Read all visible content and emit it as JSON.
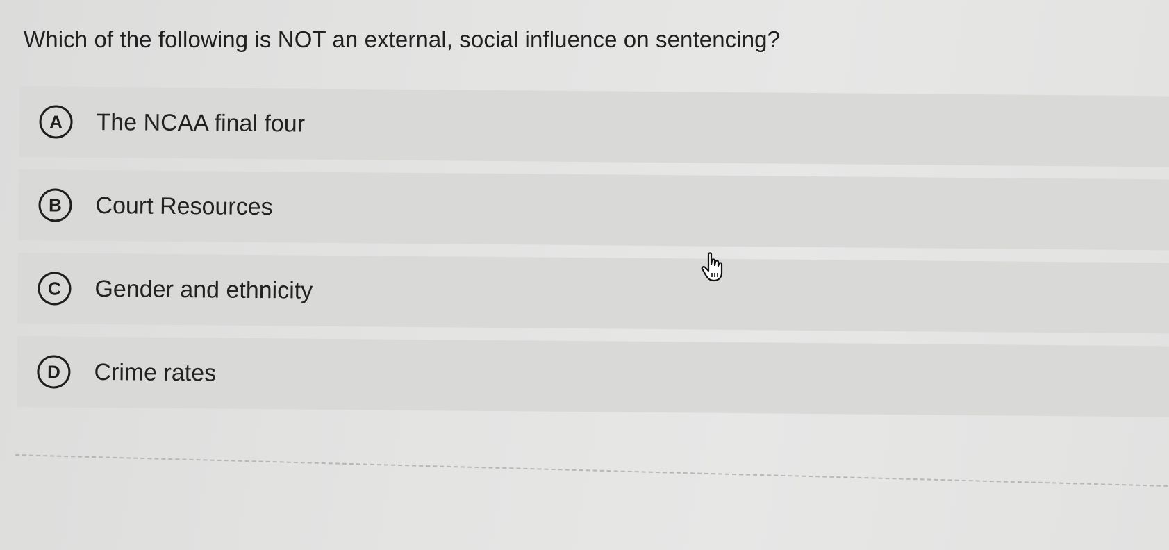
{
  "question": {
    "text": "Which of the following is NOT an external, social influence on sentencing?"
  },
  "options": [
    {
      "letter": "A",
      "text": "The NCAA final four"
    },
    {
      "letter": "B",
      "text": "Court Resources"
    },
    {
      "letter": "C",
      "text": "Gender and ethnicity"
    },
    {
      "letter": "D",
      "text": "Crime rates"
    }
  ],
  "cursor": {
    "icon": "hand-pointer-icon"
  }
}
